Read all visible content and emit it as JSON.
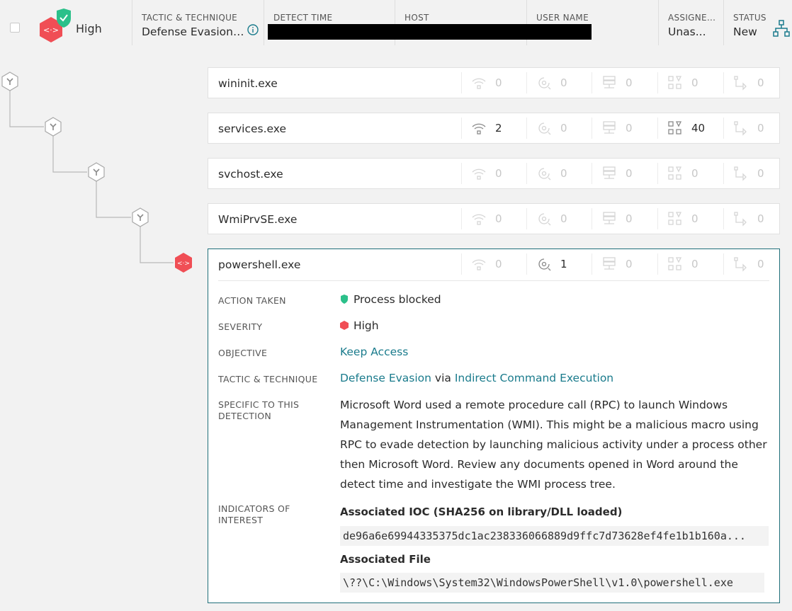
{
  "header": {
    "severity_label": "High",
    "columns": [
      {
        "header": "TACTIC & TECHNIQUE",
        "value": "Defense Evasion ..."
      },
      {
        "header": "DETECT TIME",
        "value": ""
      },
      {
        "header": "HOST",
        "value": ""
      },
      {
        "header": "USER NAME",
        "value": ""
      },
      {
        "header": "ASSIGNE...",
        "value": "Unas..."
      },
      {
        "header": "STATUS",
        "value": "New"
      }
    ]
  },
  "processes": [
    {
      "name": "wininit.exe",
      "stats": [
        "0",
        "0",
        "0",
        "0",
        "0"
      ]
    },
    {
      "name": "services.exe",
      "stats": [
        "2",
        "0",
        "0",
        "40",
        "0"
      ]
    },
    {
      "name": "svchost.exe",
      "stats": [
        "0",
        "0",
        "0",
        "0",
        "0"
      ]
    },
    {
      "name": "WmiPrvSE.exe",
      "stats": [
        "0",
        "0",
        "0",
        "0",
        "0"
      ]
    },
    {
      "name": "powershell.exe",
      "stats": [
        "0",
        "1",
        "0",
        "0",
        "0"
      ]
    }
  ],
  "detail": {
    "action_taken": {
      "label": "ACTION TAKEN",
      "value": "Process blocked"
    },
    "severity": {
      "label": "SEVERITY",
      "value": "High"
    },
    "objective": {
      "label": "OBJECTIVE",
      "value": "Keep Access"
    },
    "tactic": {
      "label": "TACTIC & TECHNIQUE",
      "tactic": "Defense Evasion",
      "via": "via",
      "technique": "Indirect Command Execution"
    },
    "specific": {
      "label_line1": "SPECIFIC TO THIS",
      "label_line2": "DETECTION",
      "text": "Microsoft Word used a remote procedure call (RPC) to launch Windows Management Instrumentation (WMI). This might be a malicious macro using RPC to evade detection by launching malicious activity under a process other then Microsoft Word. Review any documents opened in Word around the detect time and investigate the WMI process tree."
    },
    "indicators": {
      "label_line1": "INDICATORS OF",
      "label_line2": "INTEREST",
      "ioc_heading": "Associated IOC (SHA256 on library/DLL loaded)",
      "ioc_value": "de96a6e69944335375dc1ac238336066889d9ffc7d73628ef4fe1b1b160a...",
      "file_heading": "Associated File",
      "file_value": "\\??\\C:\\Windows\\System32\\WindowsPowerShell\\v1.0\\powershell.exe"
    }
  },
  "colors": {
    "accent": "#1a7b8c",
    "severity_high": "#f04e55",
    "blocked": "#2bc08a",
    "selected_border": "#1f6f7a"
  },
  "icons": [
    "network-icon",
    "dns-icon",
    "disk-icon",
    "registry-icon",
    "process-spawn-icon"
  ]
}
